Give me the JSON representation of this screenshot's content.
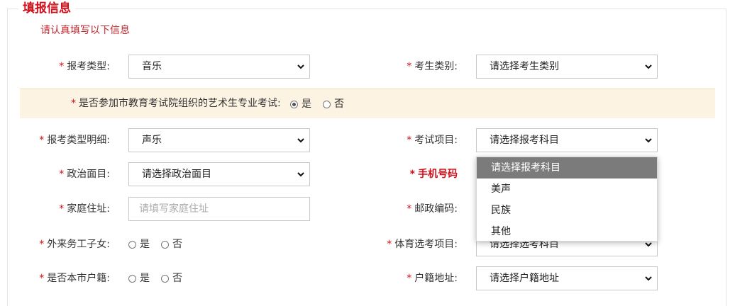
{
  "section": {
    "title": "填报信息",
    "subtitle": "请认真填写以下信息"
  },
  "form": {
    "exam_type": {
      "label": "报考类型:",
      "value": "音乐"
    },
    "candidate_category": {
      "label": "考生类别:",
      "value": "请选择考生类别"
    },
    "art_exam_question": {
      "label": "是否参加市教育考试院组织的艺术生专业考试:",
      "yes": "是",
      "no": "否",
      "selected": "yes"
    },
    "exam_type_detail": {
      "label": "报考类型明细:",
      "value": "声乐"
    },
    "exam_subject": {
      "label": "考试项目:",
      "value": "请选择报考科目"
    },
    "political_status": {
      "label": "政治面目:",
      "value": "请选择政治面目"
    },
    "mobile": {
      "label": "手机号码"
    },
    "home_address": {
      "label": "家庭住址:",
      "placeholder": "请填写家庭住址"
    },
    "postal_code": {
      "label": "邮政编码:"
    },
    "migrant_child": {
      "label": "外来务工子女:",
      "yes": "是",
      "no": "否"
    },
    "pe_subject": {
      "label": "体育选考项目:",
      "value": "请选择选考科目"
    },
    "local_hukou": {
      "label": "是否本市户籍:",
      "yes": "是",
      "no": "否"
    },
    "hukou_address": {
      "label": "户籍地址:",
      "value": "请选择户籍地址"
    }
  },
  "subject_dropdown": {
    "options": [
      "请选择报考科目",
      "美声",
      "民族",
      "其他"
    ],
    "highlighted": "请选择报考科目"
  },
  "colors": {
    "required_star": "#d0111b",
    "banner_bg": "#fdf3e3",
    "highlight": "#7b7b7b"
  }
}
